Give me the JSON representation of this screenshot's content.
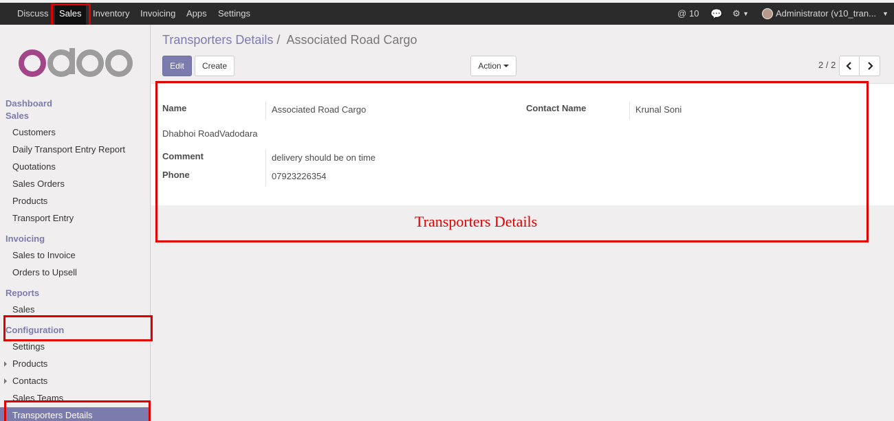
{
  "topbar": {
    "apps": [
      "Discuss",
      "Sales",
      "Inventory",
      "Invoicing",
      "Apps",
      "Settings"
    ],
    "active_app": "Sales",
    "notifications": "10",
    "user": "Administrator (v10_tran..."
  },
  "sidebar": {
    "logo_text": "odoo",
    "sections": {
      "dashboard": "Dashboard",
      "sales": "Sales",
      "sales_items": [
        "Customers",
        "Daily Transport Entry Report",
        "Quotations",
        "Sales Orders",
        "Products",
        "Transport Entry"
      ],
      "invoicing": "Invoicing",
      "invoicing_items": [
        "Sales to Invoice",
        "Orders to Upsell"
      ],
      "reports": "Reports",
      "reports_items": [
        "Sales"
      ],
      "configuration": "Configuration",
      "configuration_items": [
        "Settings",
        "Products",
        "Contacts",
        "Sales Teams",
        "Transporters Details"
      ]
    }
  },
  "breadcrumb": {
    "parent": "Transporters Details",
    "separator": "/",
    "current": "Associated Road Cargo"
  },
  "buttons": {
    "edit": "Edit",
    "create": "Create",
    "action": "Action"
  },
  "pager": "2 / 2",
  "form": {
    "name_label": "Name",
    "name_value": "Associated Road Cargo",
    "contact_label": "Contact Name",
    "contact_value": "Krunal Soni",
    "address": "Dhabhoi RoadVadodara",
    "comment_label": "Comment",
    "comment_value": "delivery should be on time",
    "phone_label": "Phone",
    "phone_value": "07923226354"
  },
  "annotation": {
    "caption": "Transporters Details",
    "color": "#e00000"
  },
  "colors": {
    "brand": "#7c7bad",
    "navbar": "#2b2b2b"
  }
}
